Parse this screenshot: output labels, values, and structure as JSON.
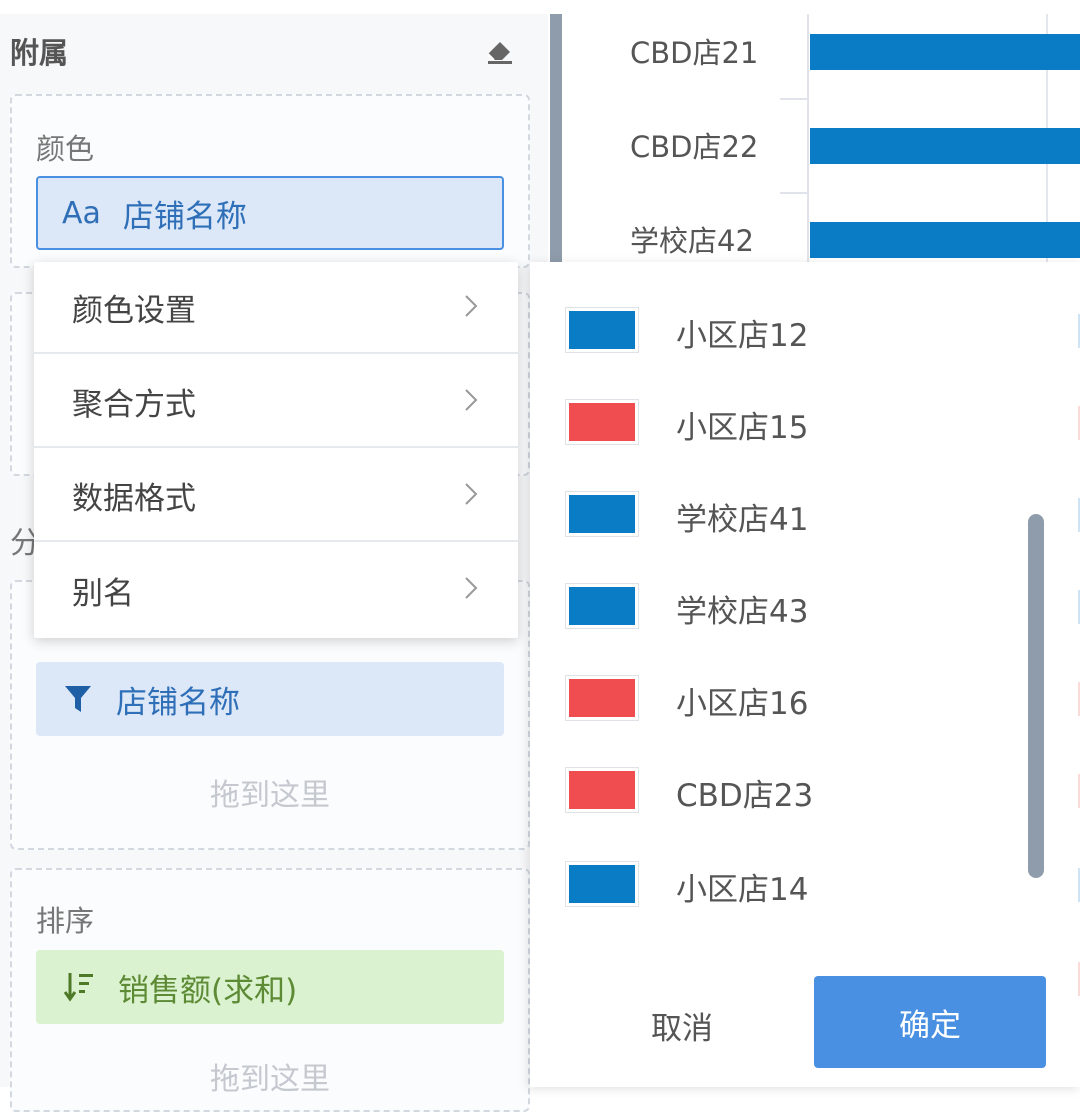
{
  "attachment": {
    "title": "附属",
    "color_label": "颜色",
    "color_field_prefix": "Aa",
    "color_field": "店铺名称",
    "partial_label": "分"
  },
  "filter": {
    "field": "店铺名称",
    "drop_hint": "拖到这里"
  },
  "sort": {
    "label": "排序",
    "field": "销售额(求和)",
    "drop_hint": "拖到这里"
  },
  "context_menu": {
    "items": [
      {
        "label": "颜色设置"
      },
      {
        "label": "聚合方式"
      },
      {
        "label": "数据格式"
      },
      {
        "label": "别名"
      }
    ]
  },
  "color_list": {
    "items": [
      {
        "label": "小区店12",
        "color": "#0a7cc6"
      },
      {
        "label": "小区店15",
        "color": "#ef4d50"
      },
      {
        "label": "学校店41",
        "color": "#0a7cc6"
      },
      {
        "label": "学校店43",
        "color": "#0a7cc6"
      },
      {
        "label": "小区店16",
        "color": "#ef4d50"
      },
      {
        "label": "CBD店23",
        "color": "#ef4d50"
      },
      {
        "label": "小区店14",
        "color": "#0a7cc6"
      }
    ],
    "cancel_label": "取消",
    "confirm_label": "确定"
  },
  "colors": {
    "accent": "#4a90e2",
    "blue_series": "#0a7cc6",
    "red_series": "#ef4d50"
  },
  "chart_data": {
    "type": "bar",
    "orientation": "horizontal",
    "categories": [
      "CBD店21",
      "CBD店22",
      "学校店42"
    ],
    "series": [
      {
        "values": [
          1,
          1,
          1
        ]
      }
    ],
    "grid": true
  }
}
